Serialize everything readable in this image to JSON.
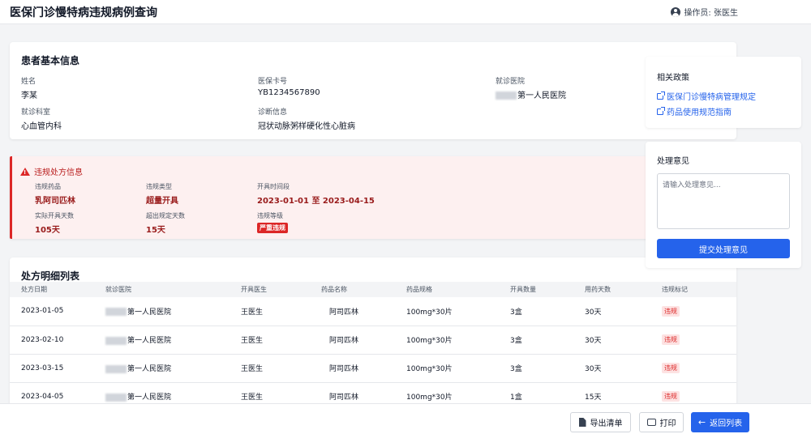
{
  "header": {
    "title": "医保门诊慢特病违规病例查询",
    "operator": "操作员: 张医生"
  },
  "patient": {
    "title": "患者基本信息",
    "fields": [
      {
        "label": "姓名",
        "value": "李某"
      },
      {
        "label": "医保卡号",
        "value": "YB1234567890"
      },
      {
        "label": "就诊医院",
        "value": "第一人民医院"
      },
      {
        "label": "就诊科室",
        "value": "心血管内科"
      },
      {
        "label": "诊断信息",
        "value": "冠状动脉粥样硬化性心脏病"
      }
    ]
  },
  "violation": {
    "title": "违规处方信息",
    "fields": [
      {
        "label": "违规药品",
        "value": "乳阿司匹林"
      },
      {
        "label": "违规类型",
        "value": "超量开具"
      },
      {
        "label": "开具时间段",
        "value": "2023-01-01 至 2023-04-15"
      },
      {
        "label": "实际开具天数",
        "value": "105天"
      },
      {
        "label": "超出规定天数",
        "value": "15天"
      },
      {
        "label": "违规等级",
        "value": "严重违规"
      }
    ]
  },
  "prescriptions": {
    "title": "处方明细列表",
    "columns": [
      "处方日期",
      "就诊医院",
      "开具医生",
      "药品名称",
      "药品规格",
      "开具数量",
      "用药天数",
      "违规标记"
    ],
    "rows": [
      [
        "2023-01-05",
        "第一人民医院",
        "王医生",
        "阿司匹林",
        "100mg*30片",
        "3盒",
        "30天",
        "违规"
      ],
      [
        "2023-02-10",
        "第一人民医院",
        "王医生",
        "阿司匹林",
        "100mg*30片",
        "3盒",
        "30天",
        "违规"
      ],
      [
        "2023-03-15",
        "第一人民医院",
        "王医生",
        "阿司匹林",
        "100mg*30片",
        "3盒",
        "30天",
        "违规"
      ],
      [
        "2023-04-05",
        "第一人民医院",
        "王医生",
        "阿司匹林",
        "100mg*30片",
        "1盒",
        "15天",
        "违规"
      ]
    ]
  },
  "policy": {
    "title": "相关政策",
    "links": [
      "医保门诊慢特病管理规定",
      "药品使用规范指南"
    ]
  },
  "opinion": {
    "title": "处理意见",
    "placeholder": "请输入处理意见...",
    "submit_label": "提交处理意见"
  },
  "footer": {
    "export_label": "导出清单",
    "print_label": "打印",
    "back_label": "返回列表"
  }
}
